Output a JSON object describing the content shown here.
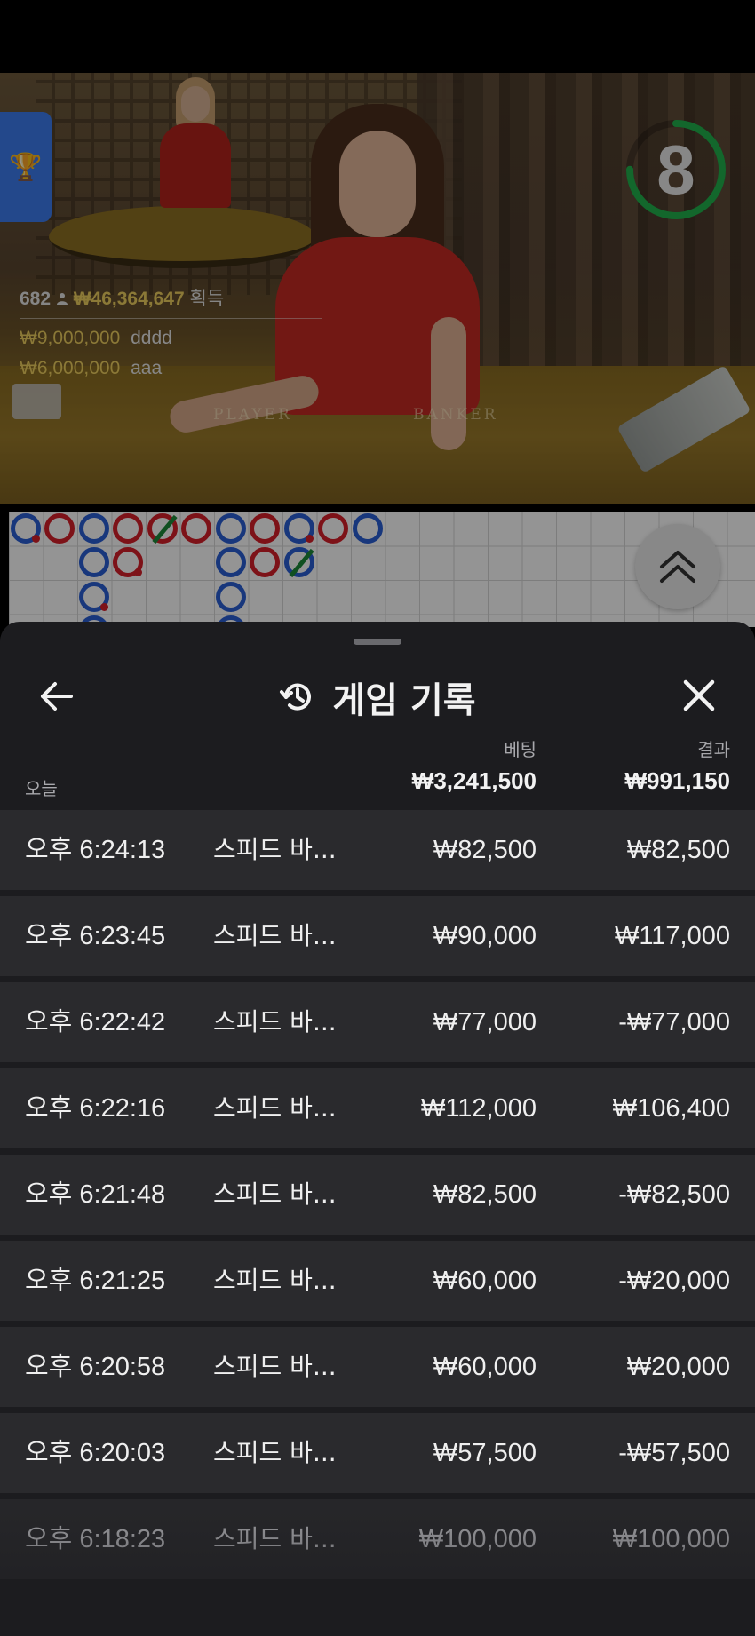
{
  "stream": {
    "countdown": "8",
    "countdown_progress": 0.75,
    "felt_left": "PLAYER",
    "felt_right": "BANKER",
    "winners": {
      "count": "682",
      "total": "₩46,364,647",
      "total_label": "획득",
      "entries": [
        {
          "amount": "₩9,000,000",
          "name": "dddd"
        },
        {
          "amount": "₩6,000,000",
          "name": "aaa"
        }
      ]
    }
  },
  "roadmap": {
    "colors": {
      "banker": "#d81f2a",
      "player": "#2a5fd6",
      "tie": "#1c8a3a"
    }
  },
  "sheet": {
    "title": "게임 기록",
    "summary": {
      "period_label": "오늘",
      "bet_label": "베팅",
      "result_label": "결과",
      "bet_total": "₩3,241,500",
      "result_total": "₩991,150"
    },
    "rows": [
      {
        "time": "오후 6:24:13",
        "game": "스피드 바...",
        "bet": "₩82,500",
        "result": "₩82,500"
      },
      {
        "time": "오후 6:23:45",
        "game": "스피드 바...",
        "bet": "₩90,000",
        "result": "₩117,000"
      },
      {
        "time": "오후 6:22:42",
        "game": "스피드 바...",
        "bet": "₩77,000",
        "result": "-₩77,000"
      },
      {
        "time": "오후 6:22:16",
        "game": "스피드 바...",
        "bet": "₩112,000",
        "result": "₩106,400"
      },
      {
        "time": "오후 6:21:48",
        "game": "스피드 바...",
        "bet": "₩82,500",
        "result": "-₩82,500"
      },
      {
        "time": "오후 6:21:25",
        "game": "스피드 바...",
        "bet": "₩60,000",
        "result": "-₩20,000"
      },
      {
        "time": "오후 6:20:58",
        "game": "스피드 바...",
        "bet": "₩60,000",
        "result": "₩20,000"
      },
      {
        "time": "오후 6:20:03",
        "game": "스피드 바...",
        "bet": "₩57,500",
        "result": "-₩57,500"
      },
      {
        "time": "오후 6:18:23",
        "game": "스피드 바...",
        "bet": "₩100,000",
        "result": "₩100,000"
      }
    ]
  },
  "icons": [
    "trophy-icon",
    "chevron-double-up-icon",
    "back-arrow-icon",
    "history-icon",
    "close-icon",
    "user-icon"
  ]
}
